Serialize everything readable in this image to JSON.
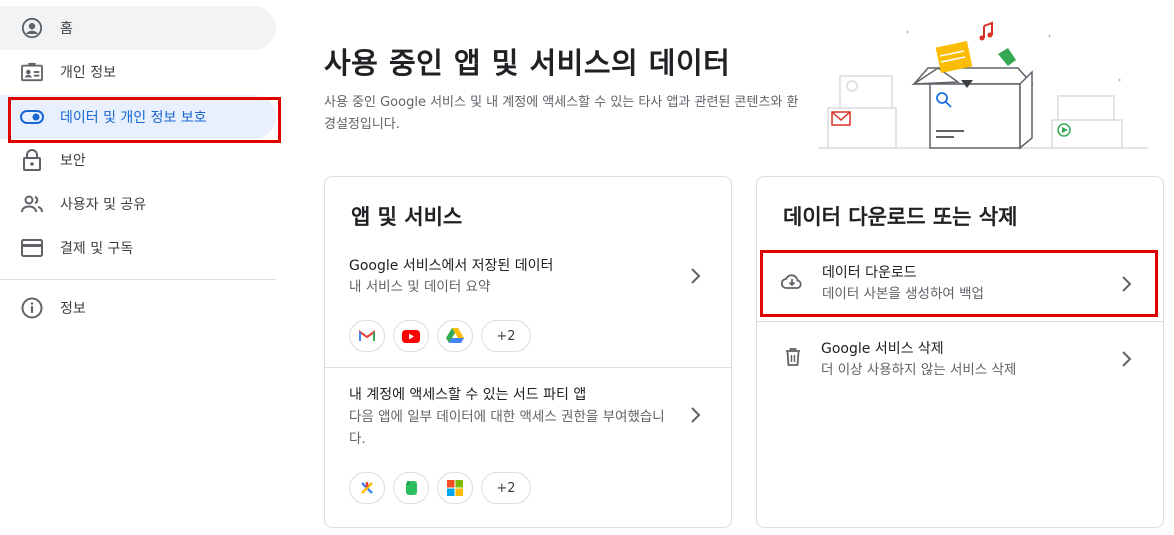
{
  "sidebar": {
    "items": [
      {
        "label": "홈",
        "icon": "account-circle-icon"
      },
      {
        "label": "개인 정보",
        "icon": "id-card-icon"
      },
      {
        "label": "데이터 및 개인 정보 보호",
        "icon": "toggle-icon"
      },
      {
        "label": "보안",
        "icon": "lock-icon"
      },
      {
        "label": "사용자 및 공유",
        "icon": "people-icon"
      },
      {
        "label": "결제 및 구독",
        "icon": "credit-card-icon"
      },
      {
        "label": "정보",
        "icon": "info-icon"
      }
    ]
  },
  "header": {
    "title": "사용 중인 앱 및 서비스의 데이터",
    "description": "사용 중인 Google 서비스 및 내 계정에 액세스할 수 있는 타사 앱과 관련된 콘텐츠와 환경설정입니다."
  },
  "apps_card": {
    "title": "앱 및 서비스",
    "rows": [
      {
        "title": "Google 서비스에서 저장된 데이터",
        "subtitle": "내 서비스 및 데이터 요약",
        "chips": [
          "gmail-icon",
          "youtube-icon",
          "drive-icon"
        ],
        "more": "+2"
      },
      {
        "title": "내 계정에 액세스할 수 있는 서드 파티 앱",
        "subtitle": "다음 앱에 일부 데이터에 대한 액세스 권한을 부여했습니다.",
        "chips": [
          "pinwheel-app-icon",
          "evernote-icon",
          "microsoft-icon"
        ],
        "more": "+2"
      }
    ]
  },
  "download_card": {
    "title": "데이터 다운로드 또는 삭제",
    "rows": [
      {
        "title": "데이터 다운로드",
        "subtitle": "데이터 사본을 생성하여 백업",
        "icon": "cloud-download-icon"
      },
      {
        "title": "Google 서비스 삭제",
        "subtitle": "더 이상 사용하지 않는 서비스 삭제",
        "icon": "trash-icon"
      }
    ]
  },
  "colors": {
    "active_bg": "#e8f0fe",
    "active_text": "#1967d2",
    "highlight_border": "#e00000"
  }
}
